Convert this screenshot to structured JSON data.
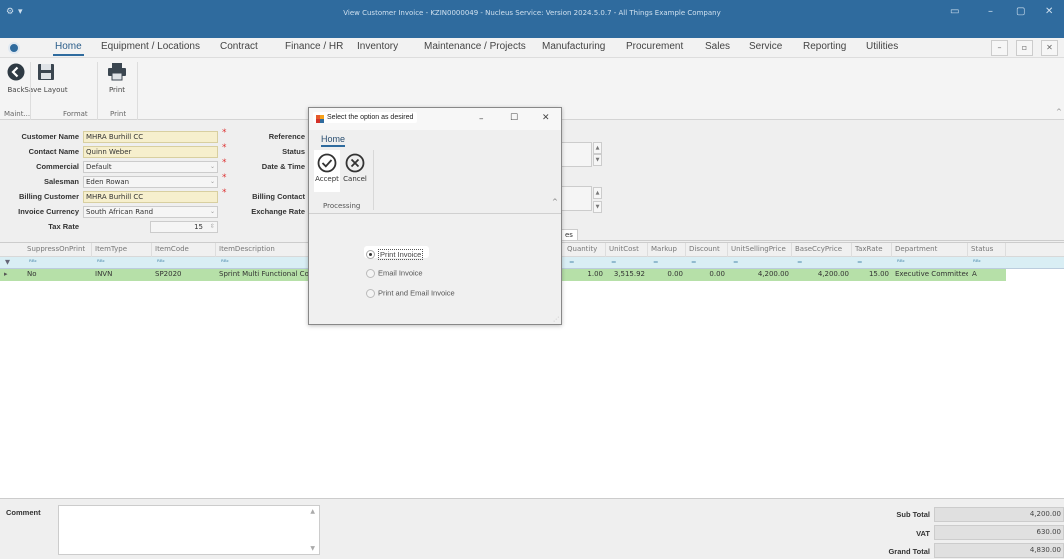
{
  "window": {
    "title": "View Customer Invoice - KZIN0000049 - Nucleus Service: Version 2024.5.0.7 - All Things Example Company"
  },
  "menu": {
    "items": [
      "Home",
      "Equipment / Locations",
      "Contract",
      "Finance / HR",
      "Inventory",
      "Maintenance / Projects",
      "Manufacturing",
      "Procurement",
      "Sales",
      "Service",
      "Reporting",
      "Utilities"
    ]
  },
  "ribbon": {
    "back": "Back",
    "save_layout": "Save Layout",
    "print": "Print",
    "groups": {
      "maint": "Maint...",
      "format": "Format",
      "print": "Print"
    }
  },
  "form": {
    "customer_name_label": "Customer Name",
    "customer_name": "MHRA Burhill CC",
    "contact_name_label": "Contact Name",
    "contact_name": "Quinn Weber",
    "commercial_label": "Commercial",
    "commercial": "Default",
    "salesman_label": "Salesman",
    "salesman": "Eden Rowan",
    "billing_customer_label": "Billing Customer",
    "billing_customer": "MHRA Burhill CC",
    "invoice_currency_label": "Invoice Currency",
    "invoice_currency": "South African Rand",
    "tax_rate_label": "Tax Rate",
    "tax_rate": "15",
    "reference_label": "Reference",
    "status_label": "Status",
    "date_time_label": "Date & Time",
    "billing_contact_label": "Billing Contact",
    "exchange_rate_label": "Exchange Rate",
    "tab_label": "es"
  },
  "grid": {
    "columns": [
      "SuppressOnPrint",
      "ItemType",
      "ItemCode",
      "ItemDescription",
      "Quantity",
      "UnitCost",
      "Markup",
      "Discount",
      "UnitSellingPrice",
      "BaseCcyPrice",
      "TaxRate",
      "Department",
      "Status"
    ],
    "row": {
      "suppress": "No",
      "item_type": "INVN",
      "item_code": "SP2020",
      "description": "Sprint Multi Functional Cop",
      "quantity": "1.00",
      "unit_cost": "3,515.92",
      "markup": "0.00",
      "discount": "0.00",
      "unit_selling": "4,200.00",
      "base_ccy": "4,200.00",
      "tax_rate": "15.00",
      "department": "Executive Committee",
      "status": "A"
    }
  },
  "footer": {
    "comment_label": "Comment",
    "sub_total_label": "Sub Total",
    "sub_total": "4,200.00",
    "vat_label": "VAT",
    "vat": "630.00",
    "grand_total_label": "Grand Total",
    "grand_total": "4,830.00"
  },
  "dialog": {
    "title": "Select the option as desired",
    "tab": "Home",
    "accept": "Accept",
    "cancel": "Cancel",
    "group": "Processing",
    "options": [
      "Print Invoice",
      "Email Invoice",
      "Print and Email Invoice"
    ],
    "selected_option": "Print Invoice"
  }
}
